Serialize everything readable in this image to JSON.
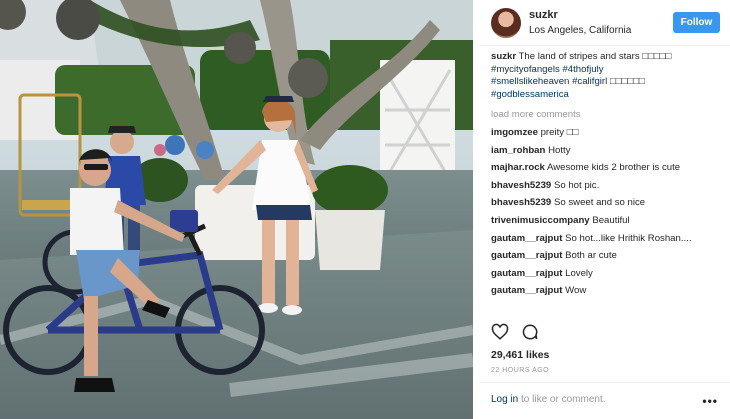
{
  "post": {
    "username": "suzkr",
    "location": "Los Angeles, California",
    "follow_label": "Follow",
    "caption": {
      "text": "The land of stripes and stars ",
      "emoji": "□□□□□",
      "hashtags": [
        "#mycityofangels",
        "#4thofjuly",
        "#smellslikeheaven",
        "#califgirl",
        "#godblessamerica"
      ],
      "emoji_after_califgirl": "□□□□□□"
    },
    "load_more": "load more comments",
    "comments": [
      {
        "user": "imgomzee",
        "text": "preity □□"
      },
      {
        "user": "iam_rohban",
        "text": "Hotty"
      },
      {
        "user": "majhar.rock",
        "text": "Awesome kids 2 brother is cute"
      },
      {
        "user": "bhavesh5239",
        "text": "So hot pic."
      },
      {
        "user": "bhavesh5239",
        "text": "So sweet and so nice"
      },
      {
        "user": "trivenimusiccompany",
        "text": "Beautiful"
      },
      {
        "user": "gautam__rajput",
        "text": "So hot...like Hrithik Roshan...."
      },
      {
        "user": "gautam__rajput",
        "text": "Both ar cute"
      },
      {
        "user": "gautam__rajput",
        "text": "Lovely"
      },
      {
        "user": "gautam__rajput",
        "text": "Wow"
      }
    ],
    "likes": "29,461 likes",
    "time": "22 HOURS AGO",
    "login_link": "Log in",
    "login_rest": " to like or comment.",
    "more_label": "•••",
    "icons": {
      "like": "heart-icon",
      "comment": "comment-icon",
      "more": "more-options-icon"
    },
    "accent": "#3897f0"
  }
}
